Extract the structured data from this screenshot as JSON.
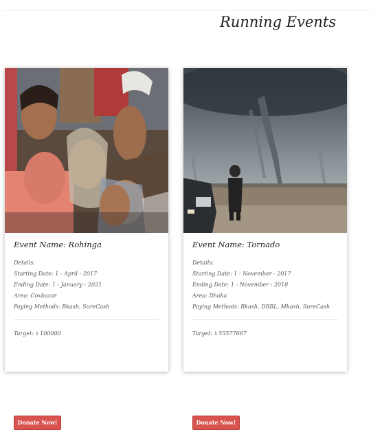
{
  "page": {
    "title": "Running Events"
  },
  "events": [
    {
      "name": "Event Name: Rohinga",
      "details_label": "Details:",
      "start": "Starting Date: 1 - April - 2017",
      "end": "Ending Date: 1 - January - 2021",
      "area": "Area: Coxbazar",
      "payment": "Paying Methods: Bkash, SureCash",
      "target": "Target: ৳ 100000",
      "button_label": "Donate Now!",
      "image": "refugee-family-photo"
    },
    {
      "name": "Event Name: Tornado",
      "details_label": "Details:",
      "start": "Starting Date: 1 - November - 2017",
      "end": "Ending Date: 1 - November - 2018",
      "area": "Area: Dhaka",
      "payment": "Paying Methods: Bkash, DBBL, Mkash, SureCash",
      "target": "Target: ৳ 55577667",
      "button_label": "Donate Now!",
      "image": "tornado-photo"
    }
  ],
  "colors": {
    "button": "#d9534f",
    "button_border": "#b83a38"
  }
}
